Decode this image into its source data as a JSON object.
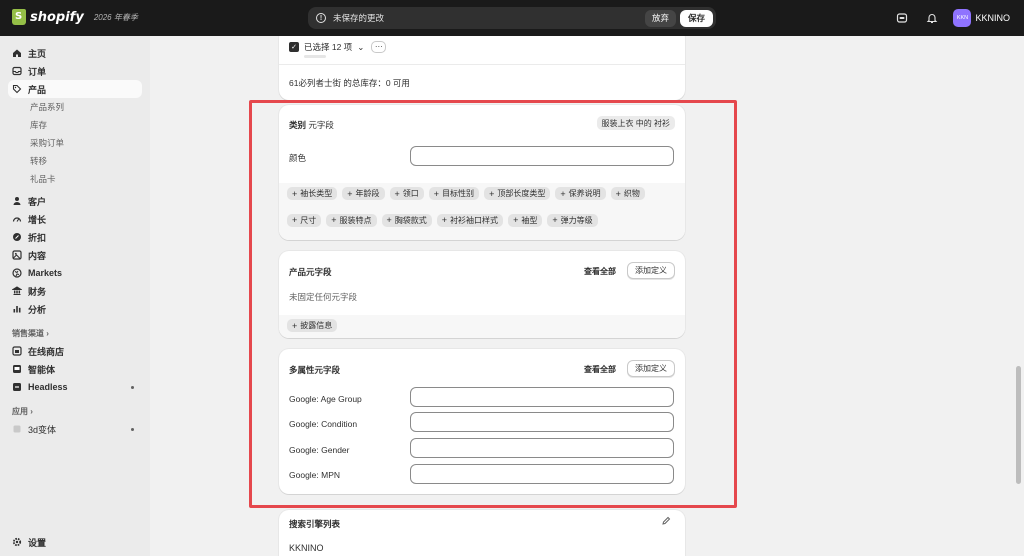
{
  "topbar": {
    "brand": "shopify",
    "edition": "2026 年春季",
    "savebar_message": "未保存的更改",
    "discard_label": "放弃",
    "save_label": "保存",
    "store_avatar": "KKN",
    "store_name": "KKNINO"
  },
  "sidebar": {
    "items": [
      {
        "label": "主页",
        "icon": "home-icon"
      },
      {
        "label": "订单",
        "icon": "orders-icon"
      },
      {
        "label": "产品",
        "icon": "tag-icon"
      }
    ],
    "product_sub": [
      "产品系列",
      "库存",
      "采购订单",
      "转移",
      "礼品卡"
    ],
    "items2": [
      {
        "label": "客户",
        "icon": "person-icon"
      },
      {
        "label": "增长",
        "icon": "gauge-icon"
      },
      {
        "label": "折扣",
        "icon": "discount-icon"
      },
      {
        "label": "内容",
        "icon": "content-icon"
      },
      {
        "label": "Markets",
        "icon": "globe-icon"
      },
      {
        "label": "财务",
        "icon": "bank-icon"
      },
      {
        "label": "分析",
        "icon": "chart-icon"
      }
    ],
    "sales_channels_label": "销售渠道",
    "channels": [
      {
        "label": "在线商店",
        "icon": "store-icon"
      },
      {
        "label": "智能体",
        "icon": "agent-icon"
      },
      {
        "label": "Headless",
        "icon": "headless-icon"
      }
    ],
    "apps_label": "应用",
    "apps": [
      {
        "label": "3d变体",
        "icon": "app-icon"
      }
    ],
    "settings_label": "设置"
  },
  "variants_card": {
    "selected_label": "已选择 12 项",
    "inventory_text": "61必列者士街 的总库存：0 可用"
  },
  "category_card": {
    "title": "类别",
    "title_suffix": "元字段",
    "category_badge": "服装上衣 中的 衬衫",
    "color_label": "颜色",
    "pills": [
      "袖长类型",
      "年龄段",
      "领口",
      "目标性别",
      "顶部长度类型",
      "保养说明",
      "织物",
      "尺寸",
      "服装特点",
      "胸袋款式",
      "衬衫袖口样式",
      "袖型",
      "弹力等级"
    ]
  },
  "product_card": {
    "title": "产品元字段",
    "view_all": "查看全部",
    "add_definition": "添加定义",
    "empty_text": "未固定任何元字段",
    "pill": "披露信息"
  },
  "multi_card": {
    "title": "多属性元字段",
    "view_all": "查看全部",
    "add_definition": "添加定义",
    "fields": [
      "Google: Age Group",
      "Google: Condition",
      "Google: Gender",
      "Google: MPN"
    ]
  },
  "seo_card": {
    "title": "搜索引擎列表",
    "store_name": "KKNINO"
  },
  "colors": {
    "highlight": "#e5484d",
    "avatar": "#8f73ff",
    "topbar": "#1a1a1a"
  }
}
